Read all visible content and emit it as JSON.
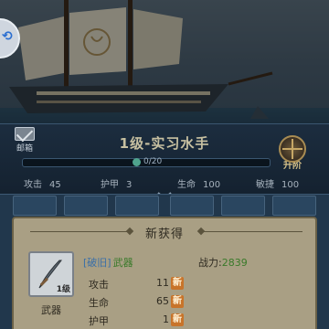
{
  "header": {
    "mail_label": "邮箱",
    "rank_title": "1级-实习水手",
    "xp_text": "0/20",
    "promote_label": "升阶",
    "stats": [
      {
        "label": "攻击",
        "value": "45"
      },
      {
        "label": "护甲",
        "value": "3"
      },
      {
        "label": "生命",
        "value": "100"
      },
      {
        "label": "敏捷",
        "value": "100"
      }
    ]
  },
  "popup": {
    "title": "新获得",
    "item": {
      "quality": "[破旧]",
      "name": "武器",
      "type_label": "武器",
      "level_label": "1级",
      "power_label": "战力:",
      "power_value": "2839",
      "attributes": [
        {
          "label": "攻击",
          "value": "11",
          "tag": "新"
        },
        {
          "label": "生命",
          "value": "65",
          "tag": "新"
        },
        {
          "label": "护甲",
          "value": "1",
          "tag": "新"
        }
      ]
    }
  },
  "colors": {
    "panel_bg": "#1c2d3f",
    "popup_bg": "#a99f84",
    "new_tag": "#c8742a",
    "green_text": "#3a7a2a",
    "quality_blue": "#3a6fa8",
    "rank_gold": "#c7c0a1"
  },
  "icons": [
    "mail-icon",
    "promote-wheel-icon",
    "xp-gem-icon",
    "sword-icon",
    "chevron-down-icon"
  ]
}
